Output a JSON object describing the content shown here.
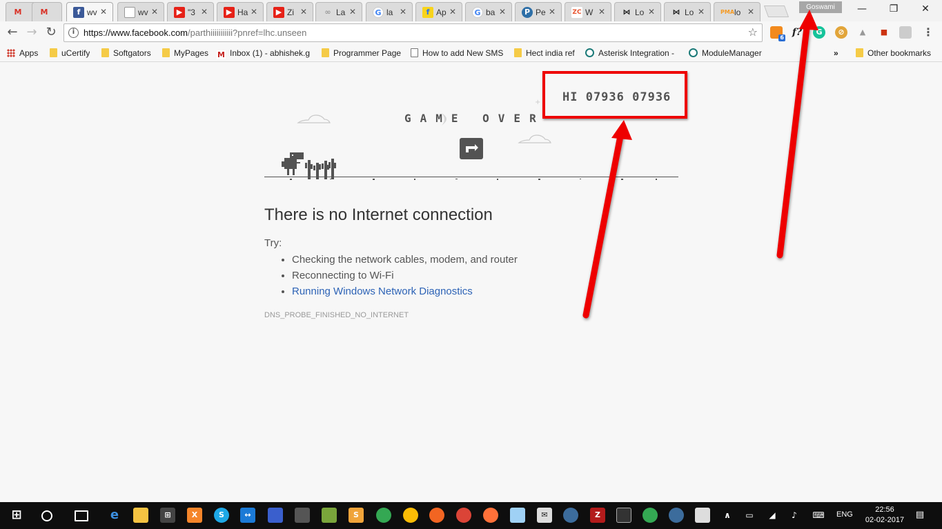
{
  "tabs": [
    {
      "title": "",
      "favicon": "gmail-icon",
      "color": "#d93025"
    },
    {
      "title": "",
      "favicon": "gmail-icon",
      "color": "#d93025"
    },
    {
      "title": "wv",
      "favicon": "facebook-icon",
      "color": "#3b5998",
      "active": true
    },
    {
      "title": "wv",
      "favicon": "document-icon",
      "color": "#9e9e9e"
    },
    {
      "title": "\"3",
      "favicon": "youtube-icon",
      "color": "#e62117"
    },
    {
      "title": "Ha",
      "favicon": "youtube-icon",
      "color": "#e62117"
    },
    {
      "title": "Zi",
      "favicon": "youtube-icon",
      "color": "#e62117"
    },
    {
      "title": "La",
      "favicon": "chain-icon",
      "color": "#aaaaaa"
    },
    {
      "title": "la",
      "favicon": "google-icon",
      "color": "#4285f4"
    },
    {
      "title": "Ap",
      "favicon": "flipkart-icon",
      "color": "#2874f0"
    },
    {
      "title": "ba",
      "favicon": "google-icon",
      "color": "#4285f4"
    },
    {
      "title": "Pe",
      "favicon": "p-icon",
      "color": "#2e6fa7"
    },
    {
      "title": "W",
      "favicon": "zc-icon",
      "color": "#e8542f"
    },
    {
      "title": "Lo",
      "favicon": "bowtie-icon",
      "color": "#222222"
    },
    {
      "title": "Lo",
      "favicon": "bowtie-icon",
      "color": "#222222"
    },
    {
      "title": "lo",
      "favicon": "phpmyadmin-icon",
      "color": "#f59a23"
    }
  ],
  "profile_name": "Goswami",
  "toolbar": {
    "url_host": "https://www.facebook.com",
    "url_rest": "/parthiiiiiiiiiii?pnref=lhc.unseen",
    "extension_badge": "6",
    "ext_f_label": "f?"
  },
  "bookmarks": {
    "apps": "Apps",
    "items": [
      "uCertify",
      "Softgators",
      "MyPages",
      "Inbox (1) - abhishek.g",
      "Programmer Page",
      "How to add New SMS",
      "Hect india ref",
      "Asterisk Integration -",
      "ModuleManager"
    ],
    "overflow": "»",
    "other": "Other bookmarks"
  },
  "game": {
    "score_text": "HI 07936 07936",
    "game_over": "GAME OVER"
  },
  "error": {
    "heading": "There is no Internet connection",
    "try_label": "Try:",
    "suggestions": [
      "Checking the network cables, modem, and router",
      "Reconnecting to Wi-Fi"
    ],
    "link_suggestion": "Running Windows Network Diagnostics",
    "code": "DNS_PROBE_FINISHED_NO_INTERNET"
  },
  "taskbar": {
    "time": "22:56",
    "date": "02-02-2017",
    "language": "ENG"
  },
  "colors": {
    "annotation_red": "#e00000",
    "link_blue": "#2d63b6",
    "dino_gray": "#535353"
  }
}
